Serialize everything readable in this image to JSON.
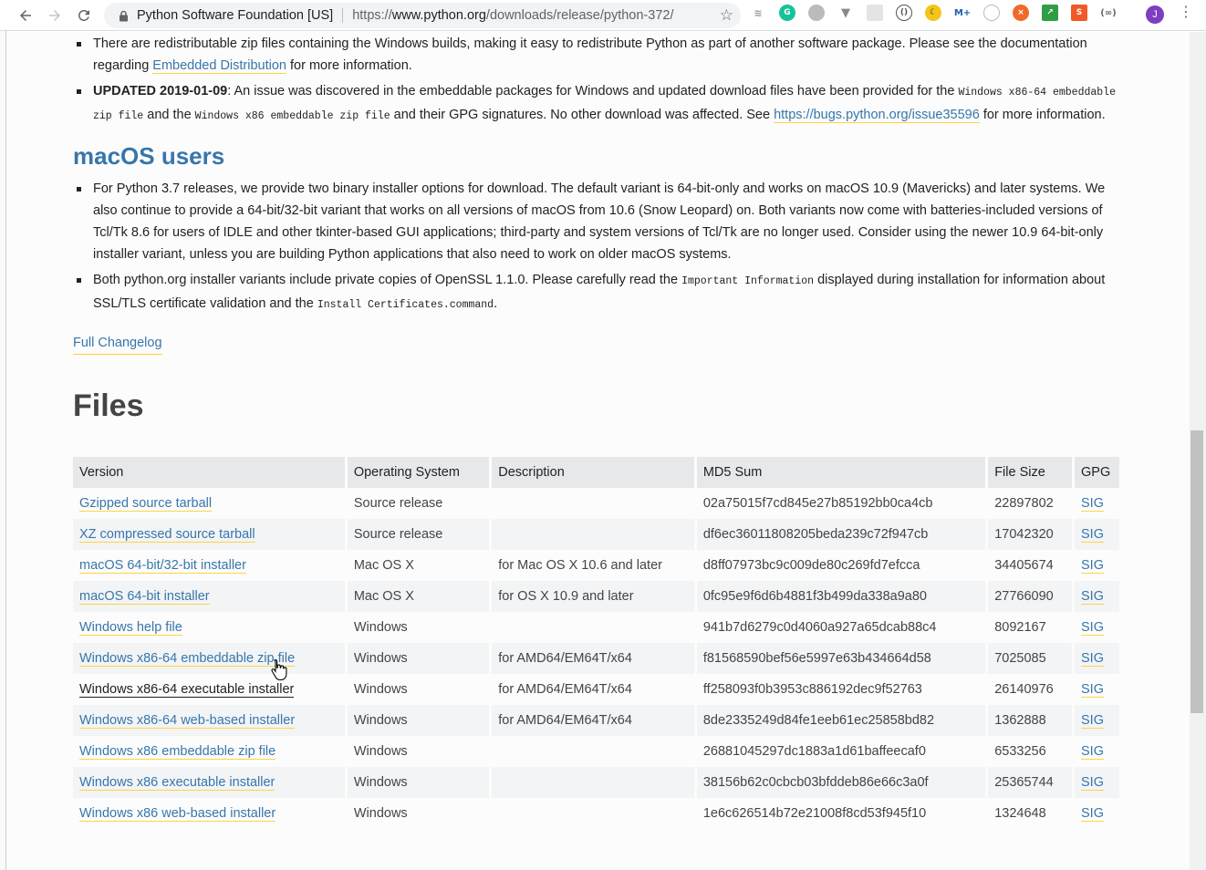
{
  "browser": {
    "site_name": "Python Software Foundation [US]",
    "url_scheme": "https://",
    "url_host": "www.python.org",
    "url_path": "/downloads/release/python-372/",
    "avatar_letter": "J"
  },
  "windows_notes": {
    "item1_text": "There are redistributable zip files containing the Windows builds, making it easy to redistribute Python as part of another software package. Please see the documentation regarding",
    "item1_link": "Embedded Distribution",
    "item1_tail": "for more information.",
    "item2_bold": "UPDATED 2019-01-09",
    "item2_a": ": An issue was discovered in the embeddable packages for Windows and updated download files have been provided for the",
    "item2_code1": "Windows x86-64 embeddable zip file",
    "item2_b": "and the",
    "item2_code2": "Windows x86 embeddable zip file",
    "item2_c": "and their GPG signatures. No other download was affected. See",
    "item2_link": "https://bugs.python.org/issue35596",
    "item2_d": "for more information."
  },
  "macos": {
    "heading": "macOS users",
    "item1": "For Python 3.7 releases, we provide two binary installer options for download. The default variant is 64-bit-only and works on macOS 10.9 (Mavericks) and later systems. We also continue to provide a 64-bit/32-bit variant that works on all versions of macOS from 10.6 (Snow Leopard) on. Both variants now come with batteries-included versions of Tcl/Tk 8.6 for users of IDLE and other tkinter-based GUI applications; third-party and system versions of Tcl/Tk are no longer used. Consider using the newer 10.9 64-bit-only installer variant, unless you are building Python applications that also need to work on older macOS systems.",
    "item2_a": "Both python.org installer variants include private copies of OpenSSL 1.1.0. Please carefully read the",
    "item2_code1": "Important Information",
    "item2_b": "displayed during installation for information about SSL/TLS certificate validation and the",
    "item2_code2": "Install Certificates.command",
    "item2_c": "."
  },
  "changelog_link": "Full Changelog",
  "files": {
    "heading": "Files",
    "columns": [
      "Version",
      "Operating System",
      "Description",
      "MD5 Sum",
      "File Size",
      "GPG"
    ],
    "rows": [
      {
        "version": "Gzipped source tarball",
        "os": "Source release",
        "desc": "",
        "md5": "02a75015f7cd845e27b85192bb0ca4cb",
        "size": "22897802",
        "gpg": "SIG"
      },
      {
        "version": "XZ compressed source tarball",
        "os": "Source release",
        "desc": "",
        "md5": "df6ec36011808205beda239c72f947cb",
        "size": "17042320",
        "gpg": "SIG"
      },
      {
        "version": "macOS 64-bit/32-bit installer",
        "os": "Mac OS X",
        "desc": "for Mac OS X 10.6 and later",
        "md5": "d8ff07973bc9c009de80c269fd7efcca",
        "size": "34405674",
        "gpg": "SIG"
      },
      {
        "version": "macOS 64-bit installer",
        "os": "Mac OS X",
        "desc": "for OS X 10.9 and later",
        "md5": "0fc95e9f6d6b4881f3b499da338a9a80",
        "size": "27766090",
        "gpg": "SIG"
      },
      {
        "version": "Windows help file",
        "os": "Windows",
        "desc": "",
        "md5": "941b7d6279c0d4060a927a65dcab88c4",
        "size": "8092167",
        "gpg": "SIG"
      },
      {
        "version": "Windows x86-64 embeddable zip file",
        "os": "Windows",
        "desc": "for AMD64/EM64T/x64",
        "md5": "f81568590bef56e5997e63b434664d58",
        "size": "7025085",
        "gpg": "SIG"
      },
      {
        "version": "Windows x86-64 executable installer",
        "os": "Windows",
        "desc": "for AMD64/EM64T/x64",
        "md5": "ff258093f0b3953c886192dec9f52763",
        "size": "26140976",
        "gpg": "SIG"
      },
      {
        "version": "Windows x86-64 web-based installer",
        "os": "Windows",
        "desc": "for AMD64/EM64T/x64",
        "md5": "8de2335249d84fe1eeb61ec25858bd82",
        "size": "1362888",
        "gpg": "SIG"
      },
      {
        "version": "Windows x86 embeddable zip file",
        "os": "Windows",
        "desc": "",
        "md5": "26881045297dc1883a1d61baffeecaf0",
        "size": "6533256",
        "gpg": "SIG"
      },
      {
        "version": "Windows x86 executable installer",
        "os": "Windows",
        "desc": "",
        "md5": "38156b62c0cbcb03bfddeb86e66c3a0f",
        "size": "25365744",
        "gpg": "SIG"
      },
      {
        "version": "Windows x86 web-based installer",
        "os": "Windows",
        "desc": "",
        "md5": "1e6c626514b72e21008f8cd53f945f10",
        "size": "1324648",
        "gpg": "SIG"
      }
    ]
  }
}
